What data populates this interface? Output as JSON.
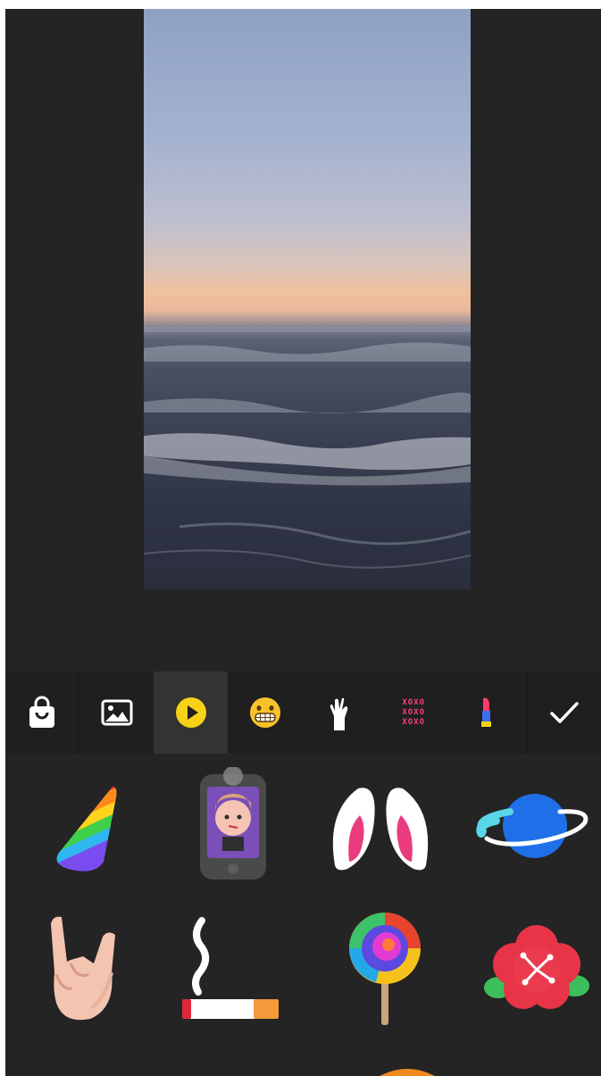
{
  "toolbar": {
    "categories": [
      {
        "icon": "shopping-bag-icon",
        "active": false
      },
      {
        "icon": "image-icon",
        "active": false
      },
      {
        "icon": "play-icon",
        "active": true
      },
      {
        "icon": "grimace-emoji-icon",
        "active": false
      },
      {
        "icon": "hand-gesture-icon",
        "active": false
      },
      {
        "icon": "xoxo-icon",
        "active": false,
        "text": [
          "XOXO",
          "XOXO",
          "XOXO"
        ]
      },
      {
        "icon": "lipstick-icon",
        "active": false
      }
    ],
    "confirm_icon": "checkmark-icon",
    "accent_color": "#f7d117"
  },
  "stickers": [
    {
      "name": "party-hat-sticker"
    },
    {
      "name": "phone-selfie-sticker"
    },
    {
      "name": "bunny-ears-sticker"
    },
    {
      "name": "planet-sticker"
    },
    {
      "name": "rock-hand-sticker"
    },
    {
      "name": "cigarette-sticker"
    },
    {
      "name": "lollipop-sticker"
    },
    {
      "name": "flower-sticker"
    }
  ]
}
